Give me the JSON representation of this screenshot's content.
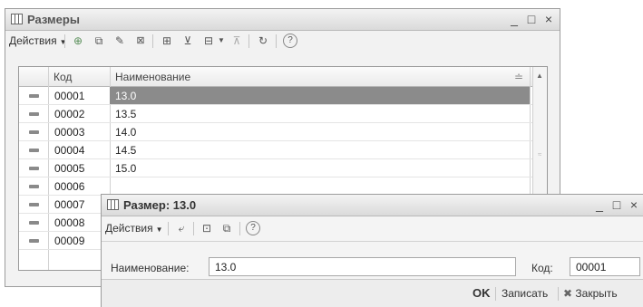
{
  "main_window": {
    "title": "Размеры",
    "actions_label": "Действия",
    "columns": {
      "code": "Код",
      "name": "Наименование"
    },
    "rows": [
      {
        "code": "00001",
        "name": "13.0",
        "selected": true
      },
      {
        "code": "00002",
        "name": "13.5"
      },
      {
        "code": "00003",
        "name": "14.0"
      },
      {
        "code": "00004",
        "name": "14.5"
      },
      {
        "code": "00005",
        "name": "15.0"
      },
      {
        "code": "00006",
        "name": ""
      },
      {
        "code": "00007",
        "name": ""
      },
      {
        "code": "00008",
        "name": ""
      },
      {
        "code": "00009",
        "name": ""
      }
    ]
  },
  "dialog": {
    "title": "Размер: 13.0",
    "actions_label": "Действия",
    "name_label": "Наименование:",
    "name_value": "13.0",
    "code_label": "Код:",
    "code_value": "00001",
    "ok_label": "OK",
    "save_label": "Записать",
    "close_label": "Закрыть"
  },
  "window_controls": {
    "minimize": "_",
    "maximize": "□",
    "close": "×"
  },
  "colors": {
    "selection": "#8b8b8b",
    "window_bg": "#f2f2f2"
  }
}
